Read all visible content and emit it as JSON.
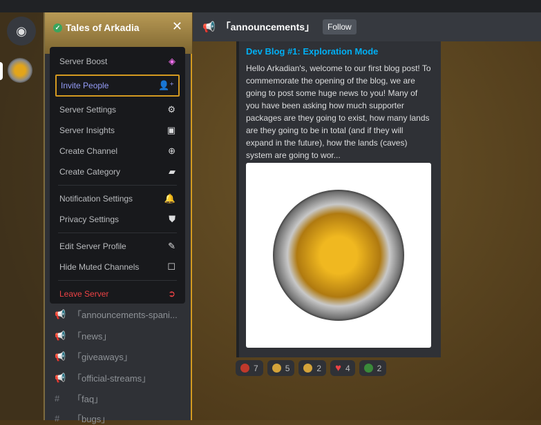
{
  "server": {
    "name": "Tales of Arkadia"
  },
  "menu": [
    {
      "label": "Server Boost",
      "icon": "boost-gem-icon",
      "glyph": "◈"
    },
    {
      "label": "Invite People",
      "icon": "add-user-icon",
      "glyph": "👤⁺"
    },
    {
      "label": "Server Settings",
      "icon": "gear-icon",
      "glyph": "⚙"
    },
    {
      "label": "Server Insights",
      "icon": "insights-icon",
      "glyph": "▣"
    },
    {
      "label": "Create Channel",
      "icon": "plus-circle-icon",
      "glyph": "⊕"
    },
    {
      "label": "Create Category",
      "icon": "folder-plus-icon",
      "glyph": "▰"
    },
    {
      "label": "Notification Settings",
      "icon": "bell-icon",
      "glyph": "🔔"
    },
    {
      "label": "Privacy Settings",
      "icon": "shield-icon",
      "glyph": "⛊"
    },
    {
      "label": "Edit Server Profile",
      "icon": "pencil-icon",
      "glyph": "✎"
    },
    {
      "label": "Hide Muted Channels",
      "icon": "checkbox-icon",
      "glyph": "☐"
    },
    {
      "label": "Leave Server",
      "icon": "leave-icon",
      "glyph": "➲"
    }
  ],
  "channels": [
    {
      "label": "「announcements-spani...",
      "icon": "megaphone-icon",
      "glyph": "📢"
    },
    {
      "label": "「news」",
      "icon": "megaphone-icon",
      "glyph": "📢"
    },
    {
      "label": "「giveaways」",
      "icon": "megaphone-icon",
      "glyph": "📢"
    },
    {
      "label": "「official-streams」",
      "icon": "megaphone-icon",
      "glyph": "📢"
    },
    {
      "label": "「faq」",
      "icon": "hashtag-icon",
      "glyph": "#"
    },
    {
      "label": "「bugs」",
      "icon": "hashtag-icon",
      "glyph": "#"
    }
  ],
  "header": {
    "channel": "「announcements」",
    "follow": "Follow"
  },
  "embed": {
    "title": "Dev Blog #1: Exploration Mode",
    "description": "Hello Arkadian's, welcome to our first blog post! To commemorate the opening of the blog, we are going to post some huge news to you! Many of you have been asking how much supporter packages are they going to exist, how many lands are they going to be in total (and if they will expand in the future), how the lands (caves) system are going to wor..."
  },
  "reactions": [
    {
      "count": "7",
      "color": "#c0392b"
    },
    {
      "count": "5",
      "color": "#d4a33a"
    },
    {
      "count": "2",
      "color": "#d4a33a"
    },
    {
      "count": "4",
      "color": "#ed4245"
    },
    {
      "count": "2",
      "color": "#3a8a3a"
    }
  ]
}
